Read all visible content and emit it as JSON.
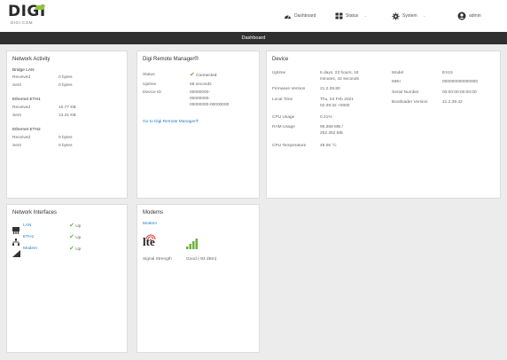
{
  "logo": {
    "word": "DIGI",
    "sub": "DIGI.COM"
  },
  "nav": {
    "dashboard": "Dashboard",
    "status": "Status",
    "system": "System",
    "user": "admin"
  },
  "page_title": "Dashboard",
  "network_activity": {
    "title": "Network Activity",
    "bridge_label": "Bridge LAN",
    "bridge_received": {
      "label": "Received",
      "value": "0 bytes"
    },
    "bridge_sent": {
      "label": "Sent",
      "value": "0 bytes"
    },
    "eth1_label": "Ethernet ETH1",
    "eth1_received": {
      "label": "Received",
      "value": "10.77 KB"
    },
    "eth1_sent": {
      "label": "Sent",
      "value": "13.31 KB"
    },
    "eth2_label": "Ethernet ETH2",
    "eth2_received": {
      "label": "Received",
      "value": "0 bytes"
    },
    "eth2_sent": {
      "label": "Sent",
      "value": "0 bytes"
    }
  },
  "remote_manager": {
    "title": "Digi Remote Manager®",
    "status": {
      "label": "Status",
      "value": "Connected"
    },
    "uptime": {
      "label": "Uptime",
      "value": "58 seconds"
    },
    "device_id": {
      "label": "Device ID",
      "lines": [
        "00000000-",
        "00000000-",
        "00000000-00000000"
      ]
    },
    "link": "Go to Digi Remote Manager®"
  },
  "device": {
    "title": "Device",
    "left": [
      {
        "label": "Uptime",
        "lines": [
          "6 days, 23 hours, 18",
          "minutes, 42 seconds"
        ]
      },
      {
        "label": "Firmware Version",
        "lines": [
          "21.2.39.80"
        ]
      },
      {
        "label": "Local Time",
        "lines": [
          "Thu, 04 Feb 2021",
          "02:39:32 +0000"
        ]
      },
      {
        "label": "CPU Usage",
        "lines": [
          "0.21%"
        ]
      },
      {
        "label": "RAM Usage",
        "lines": [
          "96.369 MB /",
          "252.352 MB"
        ]
      },
      {
        "label": "CPU Temperature",
        "lines": [
          "49.06 °C"
        ]
      }
    ],
    "right": [
      {
        "label": "Model",
        "value": "EX15"
      },
      {
        "label": "IMEI",
        "value": "000000000000000"
      },
      {
        "label": "Serial Number",
        "value": "00:00:00:00:00:00"
      },
      {
        "label": "Bootloader Version",
        "value": "21.2.39.42"
      }
    ]
  },
  "interfaces": {
    "title": "Network Interfaces",
    "items": [
      {
        "name": "LAN",
        "status": "Up"
      },
      {
        "name": "ETH1",
        "status": "Up"
      },
      {
        "name": "Modem",
        "status": "Up"
      }
    ]
  },
  "modems": {
    "title": "Modems",
    "modem_name": "Modem",
    "lte_label": "lte",
    "signal_label": "Signal Strength",
    "signal_value": "Good (-93 dBm)"
  }
}
